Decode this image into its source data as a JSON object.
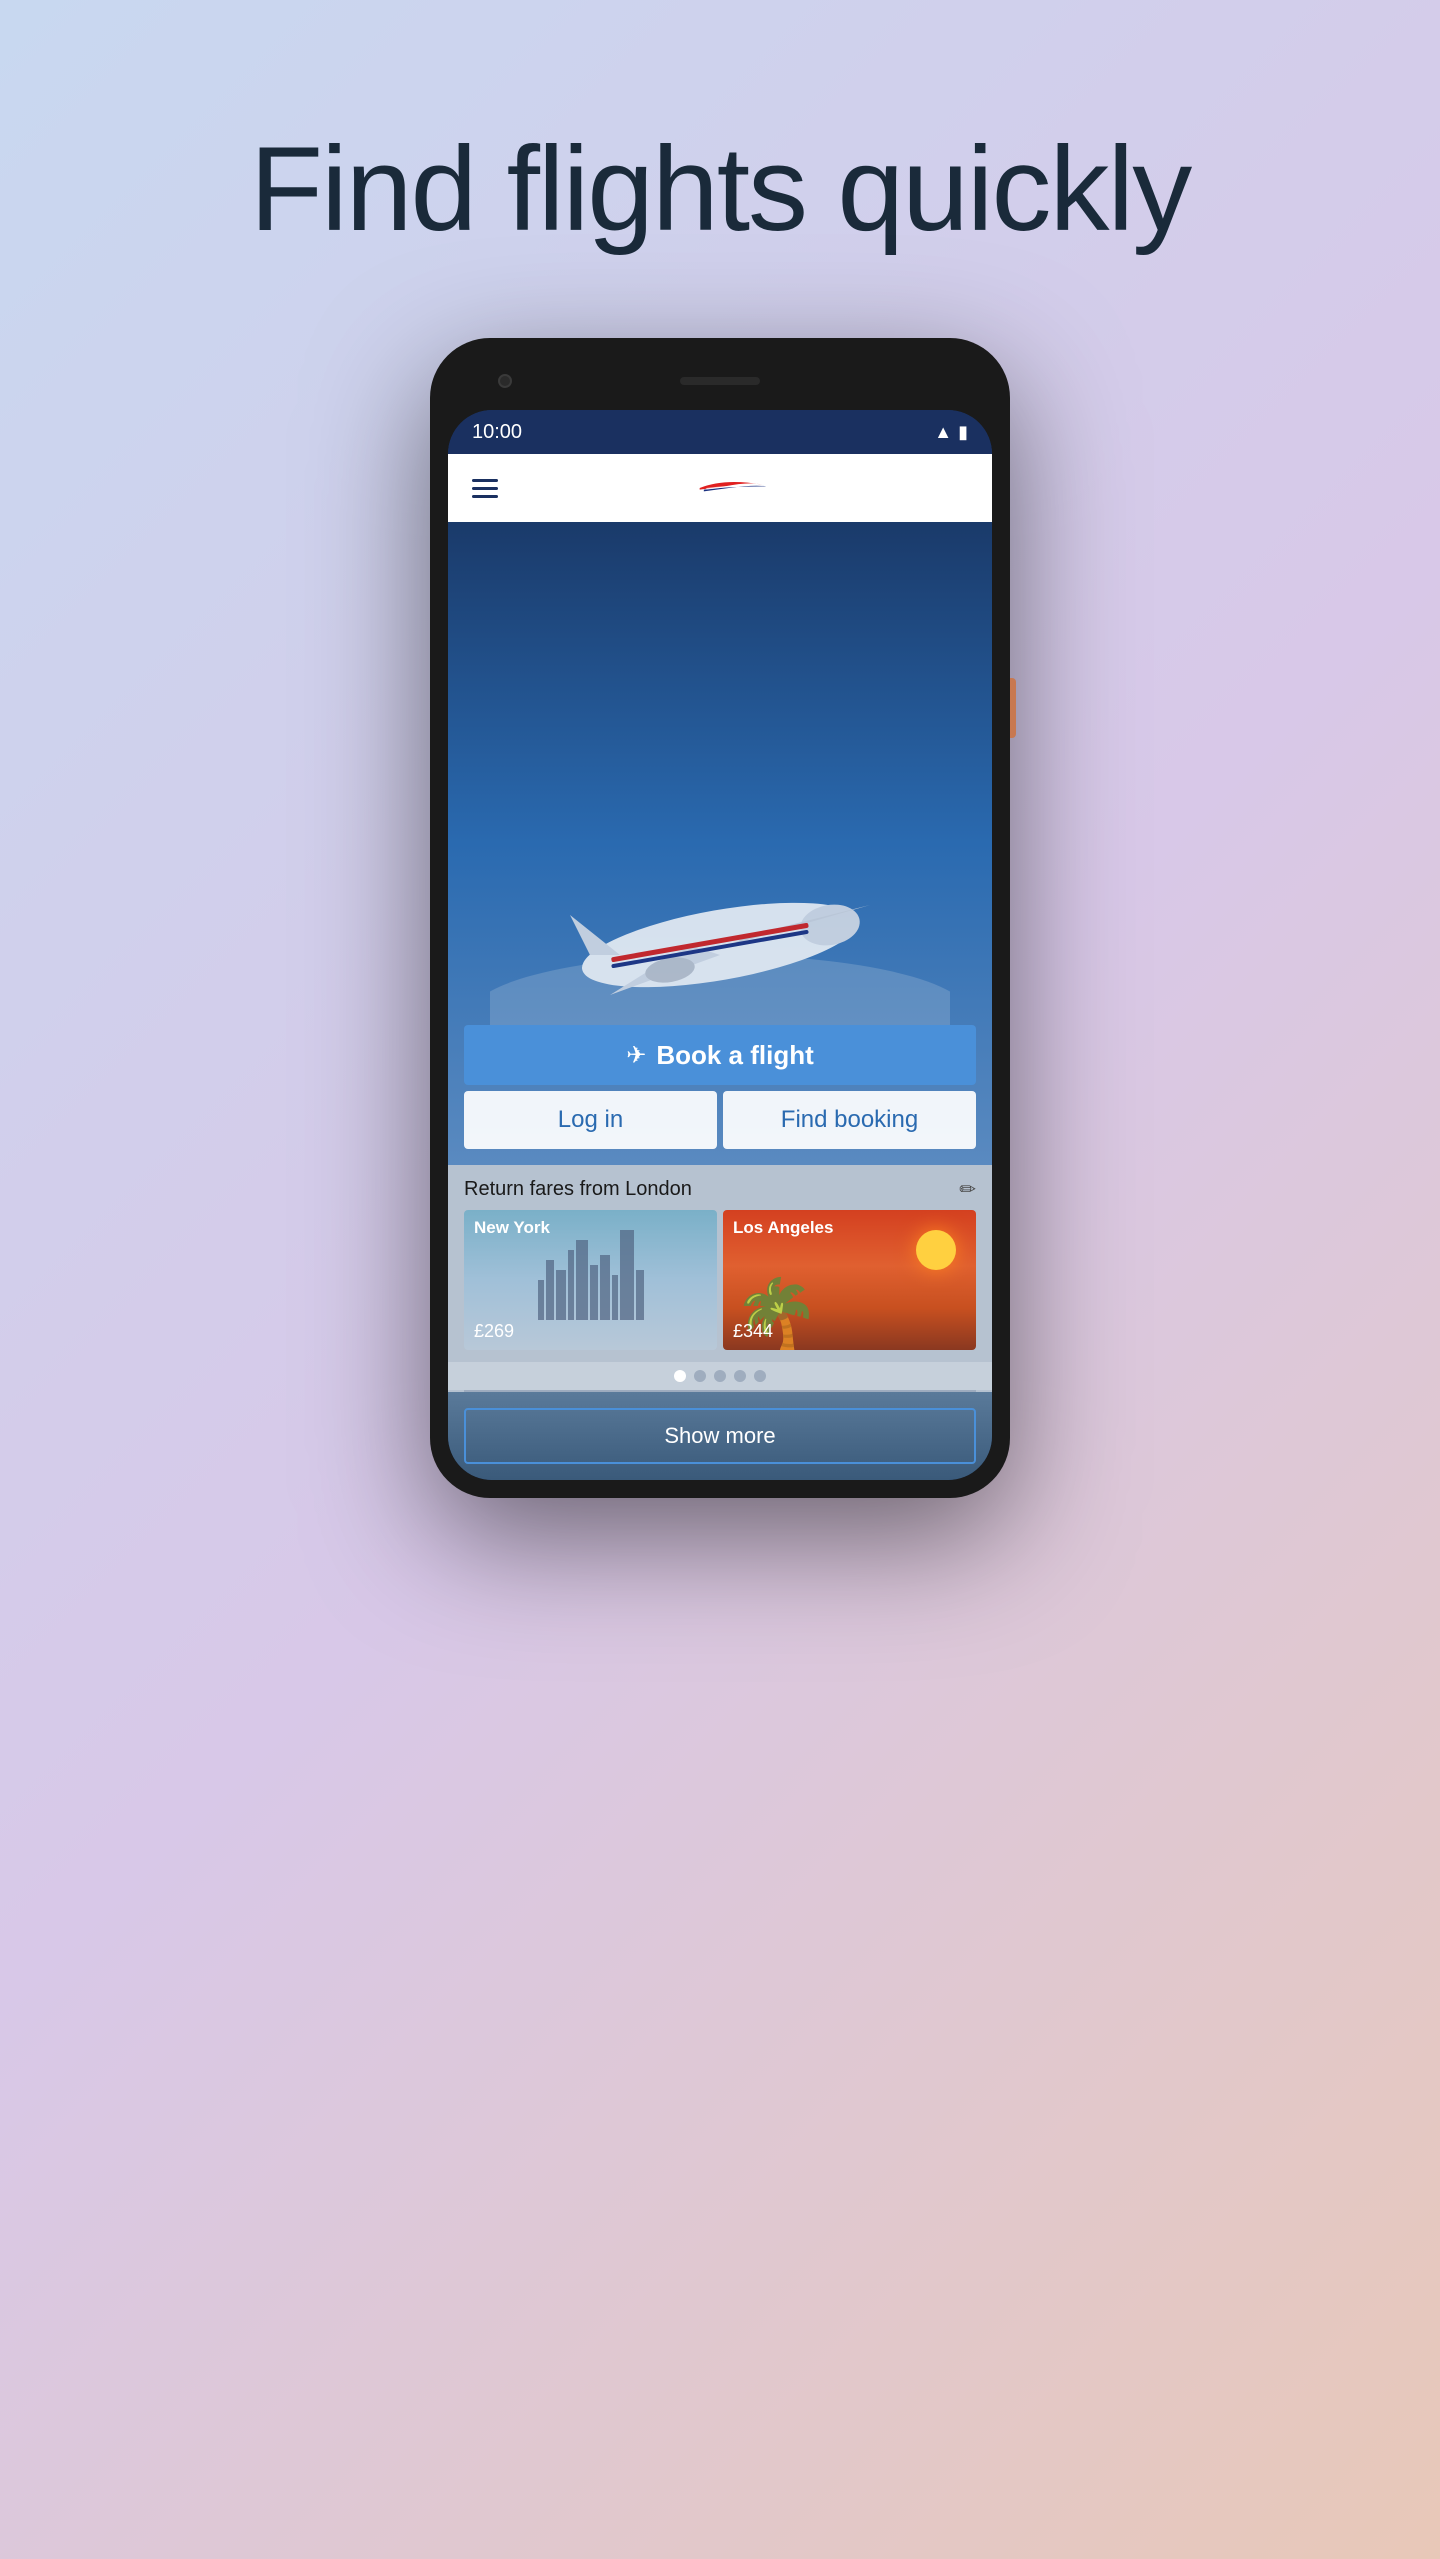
{
  "page": {
    "title": "Find flights quickly",
    "background": "linear-gradient(135deg, #c8d8f0 0%, #d8c8e8 50%, #e8c8b8 100%)"
  },
  "status_bar": {
    "time": "10:00"
  },
  "header": {
    "menu_label": "Menu"
  },
  "hero": {
    "book_flight_label": "Book a flight",
    "login_label": "Log in",
    "find_booking_label": "Find booking"
  },
  "fares": {
    "section_title": "Return fares from London",
    "destinations": [
      {
        "name": "New York",
        "price": "£269"
      },
      {
        "name": "Los Angeles",
        "price": "£344"
      }
    ],
    "carousel_dots": [
      {
        "active": true
      },
      {
        "active": false
      },
      {
        "active": false
      },
      {
        "active": false
      },
      {
        "active": false
      }
    ]
  },
  "show_more": {
    "label": "Show more"
  }
}
